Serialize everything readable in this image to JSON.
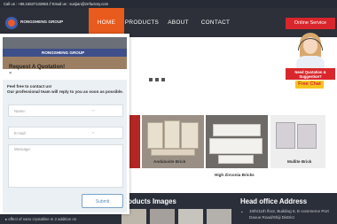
{
  "topbar": {
    "text": "Call us : +86.15537132853 // Email us : sunjian@zrrfactory.com"
  },
  "logo": {
    "text": "RONGSHENG GROUP"
  },
  "nav": {
    "home": "HOME",
    "products": "PRODUCTS",
    "about": "ABOUT",
    "contact": "CONTACT"
  },
  "service": {
    "online": "Online Service",
    "quote_line1": "Need Quotation &",
    "quote_line2": "Suggestion?",
    "chat": "Free Chat"
  },
  "products": {
    "items": [
      {
        "label": "Andalusite Brick"
      },
      {
        "label": "High Zirconia Bricks"
      },
      {
        "label": "Mullite Brick"
      }
    ]
  },
  "footer": {
    "products_heading": "Products Images",
    "office_heading": "Head office Address",
    "news_text": "effect of nano crystalline m 2 addition on",
    "address": "10th/11th floor, Building 6, E-commerce Port Daxue Road/Shiji District"
  },
  "modal": {
    "photo_text": "RONGSHENG GROUP",
    "title": "Request A Quotation!",
    "close": "×",
    "intro_line1": "Feel free to contact us!",
    "intro_line2": "Our professional team will reply to you as soon as possible.",
    "name_placeholder": "Name:",
    "email_placeholder": "E-mail:",
    "message_placeholder": "Message:",
    "required_mark": "*",
    "submit": "Submit"
  },
  "colors": {
    "accent": "#e85b1d",
    "service_red": "#d9262c",
    "chat_yellow": "#f6c421",
    "header_bg": "#2d3039"
  }
}
